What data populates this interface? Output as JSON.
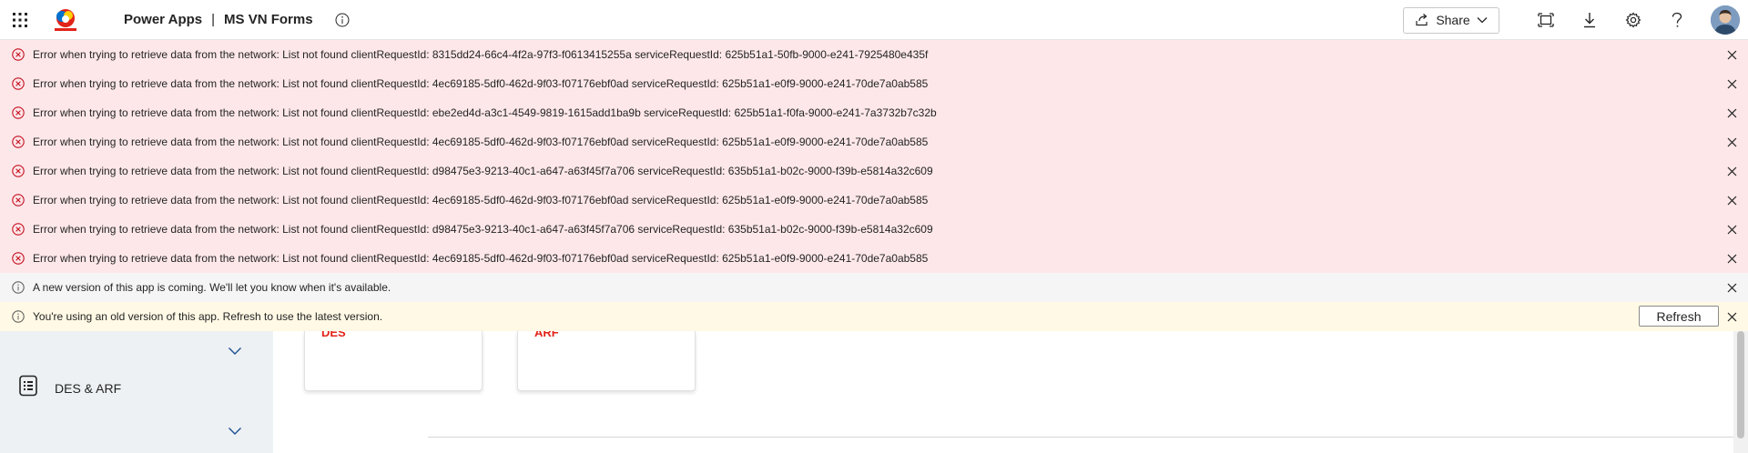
{
  "header": {
    "app_name": "Power Apps",
    "separator": "|",
    "form_name": "MS VN Forms",
    "share_label": "Share",
    "brand_color": "#e2231a"
  },
  "banners": {
    "errors": [
      "Error when trying to retrieve data from the network: List not found clientRequestId: 8315dd24-66c4-4f2a-97f3-f0613415255a serviceRequestId: 625b51a1-50fb-9000-e241-7925480e435f",
      "Error when trying to retrieve data from the network: List not found clientRequestId: 4ec69185-5df0-462d-9f03-f07176ebf0ad serviceRequestId: 625b51a1-e0f9-9000-e241-70de7a0ab585",
      "Error when trying to retrieve data from the network: List not found clientRequestId: ebe2ed4d-a3c1-4549-9819-1615add1ba9b serviceRequestId: 625b51a1-f0fa-9000-e241-7a3732b7c32b",
      "Error when trying to retrieve data from the network: List not found clientRequestId: 4ec69185-5df0-462d-9f03-f07176ebf0ad serviceRequestId: 625b51a1-e0f9-9000-e241-70de7a0ab585",
      "Error when trying to retrieve data from the network: List not found clientRequestId: d98475e3-9213-40c1-a647-a63f45f7a706 serviceRequestId: 635b51a1-b02c-9000-f39b-e5814a32c609",
      "Error when trying to retrieve data from the network: List not found clientRequestId: 4ec69185-5df0-462d-9f03-f07176ebf0ad serviceRequestId: 625b51a1-e0f9-9000-e241-70de7a0ab585",
      "Error when trying to retrieve data from the network: List not found clientRequestId: d98475e3-9213-40c1-a647-a63f45f7a706 serviceRequestId: 635b51a1-b02c-9000-f39b-e5814a32c609",
      "Error when trying to retrieve data from the network: List not found clientRequestId: 4ec69185-5df0-462d-9f03-f07176ebf0ad serviceRequestId: 625b51a1-e0f9-9000-e241-70de7a0ab585"
    ],
    "info": "A new version of this app is coming. We'll let you know when it's available.",
    "warning": "You're using an old version of this app. Refresh to use the latest version.",
    "refresh_label": "Refresh",
    "error_color": "#c50f1f"
  },
  "sidebar": {
    "item_label": "DES & ARF"
  },
  "cards": {
    "first_label": "DES",
    "second_label": "ARF"
  }
}
